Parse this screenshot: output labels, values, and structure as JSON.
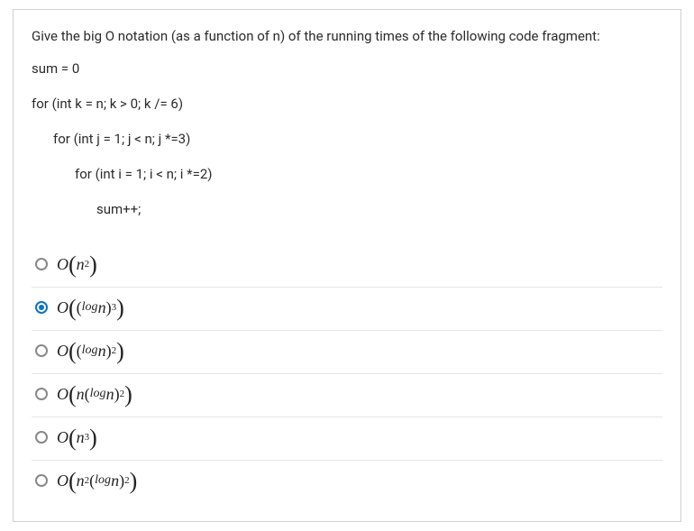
{
  "question": {
    "prompt": "Give the big O notation (as a function of n) of the running times of the following code fragment:",
    "code_lines": [
      {
        "text": "sum = 0",
        "indent": 0
      },
      {
        "text": "for (int k = n; k > 0; k /= 6)",
        "indent": 0
      },
      {
        "text": "for (int j = 1; j < n; j *=3)",
        "indent": 1
      },
      {
        "text": "for (int i = 1; i < n; i *=2)",
        "indent": 2
      },
      {
        "text": "sum++;",
        "indent": 3
      }
    ]
  },
  "options": [
    {
      "id": "opt-1",
      "selected": false,
      "label_plain": "O(n^2)",
      "math_html": "O <span class='paren-big upn'>(</span>n<sup>2</sup><span class='paren-big upn'>)</span>"
    },
    {
      "id": "opt-2",
      "selected": true,
      "label_plain": "O((log n)^3)",
      "math_html": "O <span class='paren-big upn'>(</span><span class='upn'>(</span><span class='small'>log </span>n<span class='upn'>)</span><sup>3</sup><span class='paren-big upn'>)</span>"
    },
    {
      "id": "opt-3",
      "selected": false,
      "label_plain": "O((log n)^2)",
      "math_html": "O <span class='paren-big upn'>(</span><span class='upn'>(</span><span class='small'>log </span>n<span class='upn'>)</span><sup>2</sup><span class='paren-big upn'>)</span>"
    },
    {
      "id": "opt-4",
      "selected": false,
      "label_plain": "O(n(log n)^2)",
      "math_html": "O <span class='paren-big upn'>(</span>n<span class='upn'>(</span><span class='small'>log </span>n<span class='upn'>)</span><sup>2</sup><span class='paren-big upn'>)</span>"
    },
    {
      "id": "opt-5",
      "selected": false,
      "label_plain": "O(n^3)",
      "math_html": "O <span class='paren-big upn'>(</span>n<sup>3</sup><span class='paren-big upn'>)</span>"
    },
    {
      "id": "opt-6",
      "selected": false,
      "label_plain": "O(n^2 (log n)^2)",
      "math_html": "O <span class='paren-big upn'>(</span>n<sup>2 </sup><span class='upn'>(</span><span class='small'>log </span>n<span class='upn'>)</span><sup>2</sup><span class='paren-big upn'>)</span>"
    }
  ]
}
